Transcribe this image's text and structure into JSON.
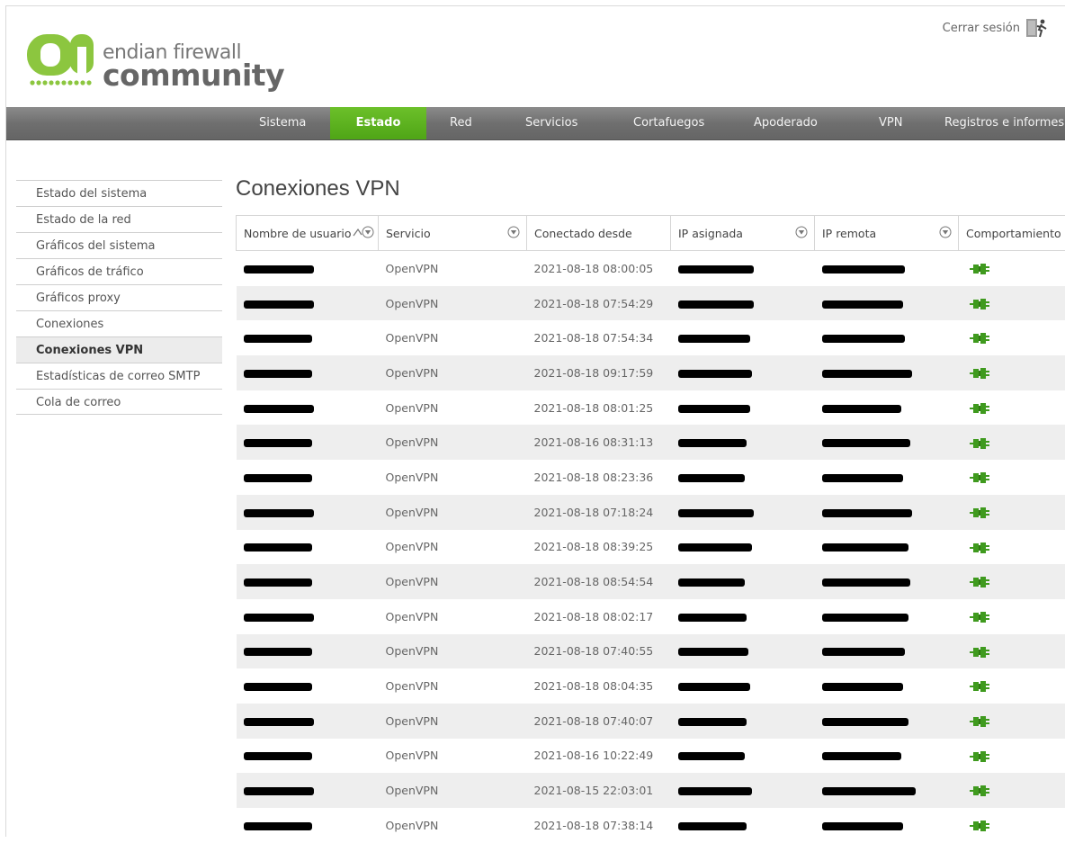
{
  "header": {
    "logo_line1": "endian firewall",
    "logo_line2": "community",
    "logout_label": "Cerrar sesión",
    "logout_icon": "door-exit-icon"
  },
  "nav": {
    "items": [
      {
        "label": "Sistema",
        "active": false
      },
      {
        "label": "Estado",
        "active": true
      },
      {
        "label": "Red",
        "active": false
      },
      {
        "label": "Servicios",
        "active": false
      },
      {
        "label": "Cortafuegos",
        "active": false
      },
      {
        "label": "Apoderado",
        "active": false
      },
      {
        "label": "VPN",
        "active": false
      },
      {
        "label": "Registros e informes",
        "active": false
      }
    ],
    "active_color": "#5cb31f",
    "bar_color": "#777777"
  },
  "sidebar": {
    "items": [
      {
        "label": "Estado del sistema",
        "active": false
      },
      {
        "label": "Estado de la red",
        "active": false
      },
      {
        "label": "Gráficos del sistema",
        "active": false
      },
      {
        "label": "Gráficos de tráfico",
        "active": false
      },
      {
        "label": "Gráficos proxy",
        "active": false
      },
      {
        "label": "Conexiones",
        "active": false
      },
      {
        "label": "Conexiones VPN",
        "active": true
      },
      {
        "label": "Estadísticas de correo SMTP",
        "active": false
      },
      {
        "label": "Cola de correo",
        "active": false
      }
    ]
  },
  "main": {
    "title": "Conexiones VPN",
    "columns": [
      {
        "label": "Nombre de usuario",
        "filter_icon": "sort-filter-icon"
      },
      {
        "label": "Servicio",
        "filter_icon": "filter-icon"
      },
      {
        "label": "Conectado desde",
        "filter_icon": null
      },
      {
        "label": "IP asignada",
        "filter_icon": "filter-icon"
      },
      {
        "label": "IP remota",
        "filter_icon": "filter-icon"
      },
      {
        "label": "Comportamiento",
        "filter_icon": null
      }
    ],
    "rows": [
      {
        "service": "OpenVPN",
        "connected_since": "2021-08-18 08:00:05"
      },
      {
        "service": "OpenVPN",
        "connected_since": "2021-08-18 07:54:29"
      },
      {
        "service": "OpenVPN",
        "connected_since": "2021-08-18 07:54:34"
      },
      {
        "service": "OpenVPN",
        "connected_since": "2021-08-18 09:17:59"
      },
      {
        "service": "OpenVPN",
        "connected_since": "2021-08-18 08:01:25"
      },
      {
        "service": "OpenVPN",
        "connected_since": "2021-08-16 08:31:13"
      },
      {
        "service": "OpenVPN",
        "connected_since": "2021-08-18 08:23:36"
      },
      {
        "service": "OpenVPN",
        "connected_since": "2021-08-18 07:18:24"
      },
      {
        "service": "OpenVPN",
        "connected_since": "2021-08-18 08:39:25"
      },
      {
        "service": "OpenVPN",
        "connected_since": "2021-08-18 08:54:54"
      },
      {
        "service": "OpenVPN",
        "connected_since": "2021-08-18 08:02:17"
      },
      {
        "service": "OpenVPN",
        "connected_since": "2021-08-18 07:40:55"
      },
      {
        "service": "OpenVPN",
        "connected_since": "2021-08-18 08:04:35"
      },
      {
        "service": "OpenVPN",
        "connected_since": "2021-08-18 07:40:07"
      },
      {
        "service": "OpenVPN",
        "connected_since": "2021-08-16 10:22:49"
      },
      {
        "service": "OpenVPN",
        "connected_since": "2021-08-15 22:03:01"
      },
      {
        "service": "OpenVPN",
        "connected_since": "2021-08-18 07:38:14"
      }
    ],
    "action_icon": "plug-disconnect-icon",
    "action_color": "#3f9a1e"
  }
}
